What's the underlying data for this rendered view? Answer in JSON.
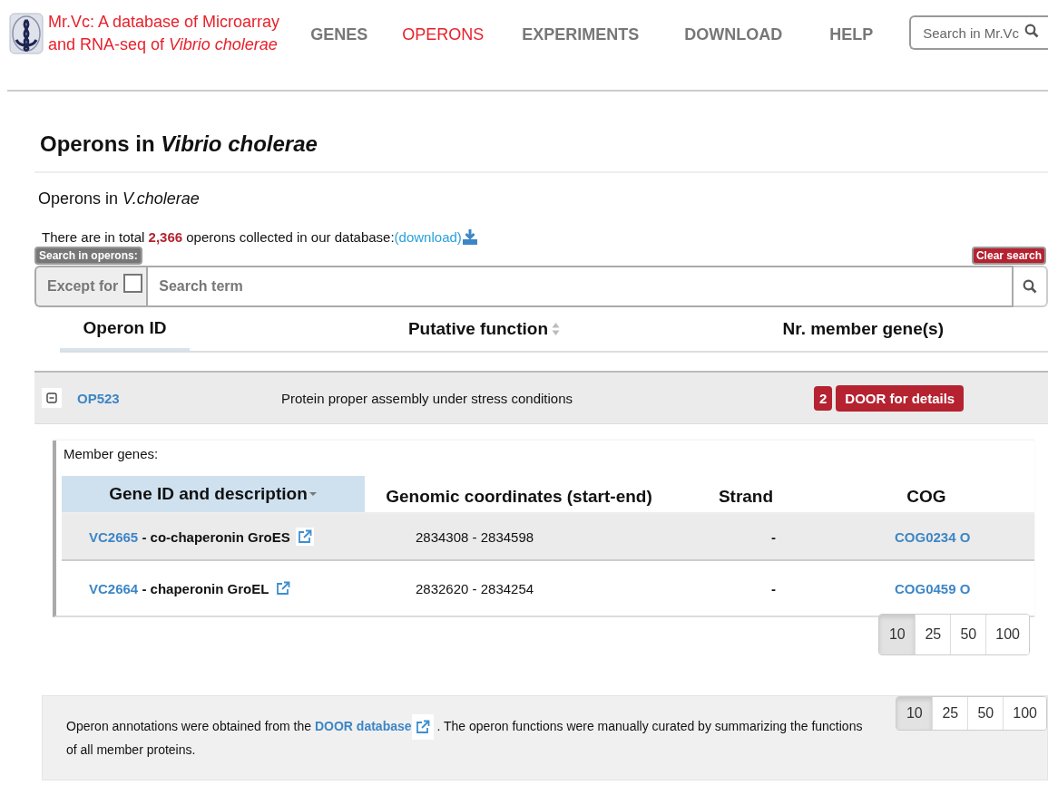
{
  "header": {
    "title_line1": "Mr.Vc: A database of Microarray",
    "title_line2": "and RNA-seq of *Vibrio cholerae*"
  },
  "nav": [
    {
      "label": "GENES",
      "selected": false
    },
    {
      "label": "OPERONS",
      "selected": true
    },
    {
      "label": "EXPERIMENTS",
      "selected": false
    },
    {
      "label": "DOWNLOAD",
      "selected": false
    },
    {
      "label": "HELP",
      "selected": false
    }
  ],
  "site_search": {
    "placeholder": "Search in Mr.Vc"
  },
  "page_title": "Operons  in *Vibrio cholerae*",
  "subtitle": "Operons in *V.cholerae*",
  "summary": {
    "text": "There are in total **2,366** operons collected in our database:",
    "link": "(download)"
  },
  "operon_search": {
    "label": "Search in operons:",
    "clear": "Clear search",
    "except_label": "Except for",
    "except_checked": false,
    "placeholder": "Search term"
  },
  "table": {
    "columns": [
      {
        "label": "Operon ID",
        "sorted": true,
        "sortable": true
      },
      {
        "label": "Putative function",
        "sorted": false,
        "sortable": true
      },
      {
        "label": "Nr. member gene(s)",
        "sorted": false,
        "sortable": false
      }
    ],
    "rows": [
      {
        "expanded": true,
        "id": "OP523",
        "function": "Protein proper assembly under stress conditions",
        "count": "2",
        "action": "DOOR for details",
        "members": {
          "label": "Member genes:",
          "columns": [
            {
              "label": "Gene ID and description",
              "sorted": true
            },
            {
              "label": "Genomic coordinates (start-end)",
              "sorted": false
            },
            {
              "label": "Strand",
              "sorted": false
            },
            {
              "label": "COG",
              "sorted": false
            }
          ],
          "rows": [
            {
              "id": "VC2665",
              "description": " - co-chaperonin GroES",
              "coordinates": "2834308 - 2834598",
              "strand": "-",
              "cog": "COG0234 O",
              "selected": true
            },
            {
              "id": "VC2664",
              "description": " - chaperonin GroEL",
              "coordinates": "2832620 - 2834254",
              "strand": "-",
              "cog": "COG0459 O",
              "selected": false
            }
          ]
        }
      }
    ]
  },
  "page_size_inner": [
    {
      "label": "10",
      "selected": true
    },
    {
      "label": "25",
      "selected": false
    },
    {
      "label": "50",
      "selected": false
    },
    {
      "label": "100",
      "selected": false
    }
  ],
  "footnote": {
    "before": "Operon annotations were obtained from the ",
    "link": "DOOR database",
    "after": " . The operon functions were manually curated by summarizing the functions of all member proteins."
  },
  "page_size_outer": [
    {
      "label": "10",
      "selected": true
    },
    {
      "label": "25",
      "selected": false
    },
    {
      "label": "50",
      "selected": false
    },
    {
      "label": "100",
      "selected": false
    }
  ]
}
